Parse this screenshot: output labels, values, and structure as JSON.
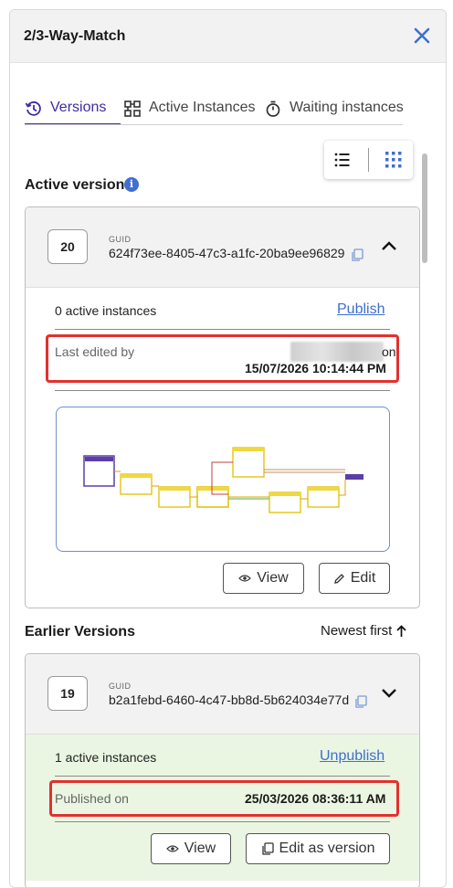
{
  "panel": {
    "title": "2/3-Way-Match"
  },
  "tabs": [
    {
      "label": "Versions",
      "icon": "history-icon",
      "active": true
    },
    {
      "label": "Active Instances",
      "icon": "grid-nodes-icon",
      "active": false
    },
    {
      "label": "Waiting instances",
      "icon": "stopwatch-icon",
      "active": false
    }
  ],
  "view_toggle": {
    "list_icon": "list-view-icon",
    "grid_icon": "grid-view-icon",
    "selected": "grid"
  },
  "active_version": {
    "section_title": "Active version",
    "version_number": "20",
    "guid_label": "GUID",
    "guid": "624f73ee-8405-47c3-a1fc-20ba9ee96829",
    "instances_text": "0 active instances",
    "action_link": "Publish",
    "edited_label": "Last edited by",
    "edited_suffix": "on",
    "edited_date": "15/07/2026 10:14:44 PM",
    "view_button": "View",
    "edit_button": "Edit"
  },
  "earlier_versions": {
    "section_title": "Earlier Versions",
    "sort_label": "Newest first",
    "items": [
      {
        "version_number": "19",
        "guid_label": "GUID",
        "guid": "b2a1febd-6460-4c47-bb8d-5b624034e77d",
        "instances_text": "1 active instances",
        "action_link": "Unpublish",
        "published_label": "Published on",
        "published_date": "25/03/2026 08:36:11 AM",
        "view_button": "View",
        "edit_button": "Edit as version"
      }
    ]
  },
  "colors": {
    "accent": "#3f2ba3",
    "link": "#3e6fd1",
    "highlight": "#e2312f",
    "published_bg": "#eaf6e2"
  }
}
